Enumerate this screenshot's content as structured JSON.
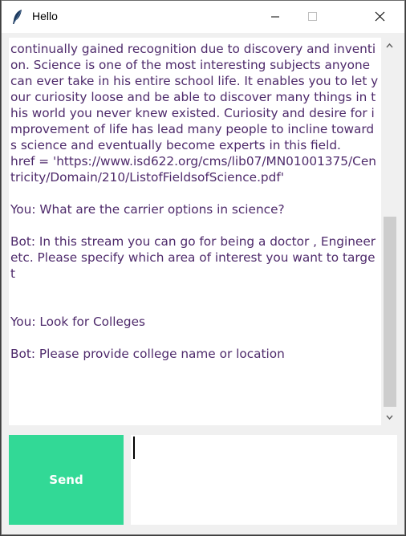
{
  "window": {
    "title": "Hello",
    "icons": {
      "app": "feather-icon",
      "minimize": "minimize-icon",
      "maximize": "maximize-icon",
      "close": "close-icon"
    }
  },
  "chat": {
    "text_color": "#4e2a6b",
    "transcript": "continually gained recognition due to discovery and invention. Science is one of the most interesting subjects anyone can ever take in his entire school life. It enables you to let your curiosity loose and be able to discover many things in this world you never knew existed. Curiosity and desire for improvement of life has lead many people to incline towards science and eventually become experts in this field.\nhref = 'https://www.isd622.org/cms/lib07/MN01001375/Centricity/Domain/210/ListofFieldsofScience.pdf'\n\nYou: What are the carrier options in science?\n\nBot: In this stream you can go for being a doctor , Engineer etc. Please specify which area of interest you want to target\n\n\nYou: Look for Colleges\n\nBot: Please provide college name or location"
  },
  "scrollbar": {
    "up_icon": "chevron-up-icon",
    "down_icon": "chevron-down-icon"
  },
  "composer": {
    "send_label": "Send",
    "send_color": "#32d996",
    "input_value": ""
  }
}
